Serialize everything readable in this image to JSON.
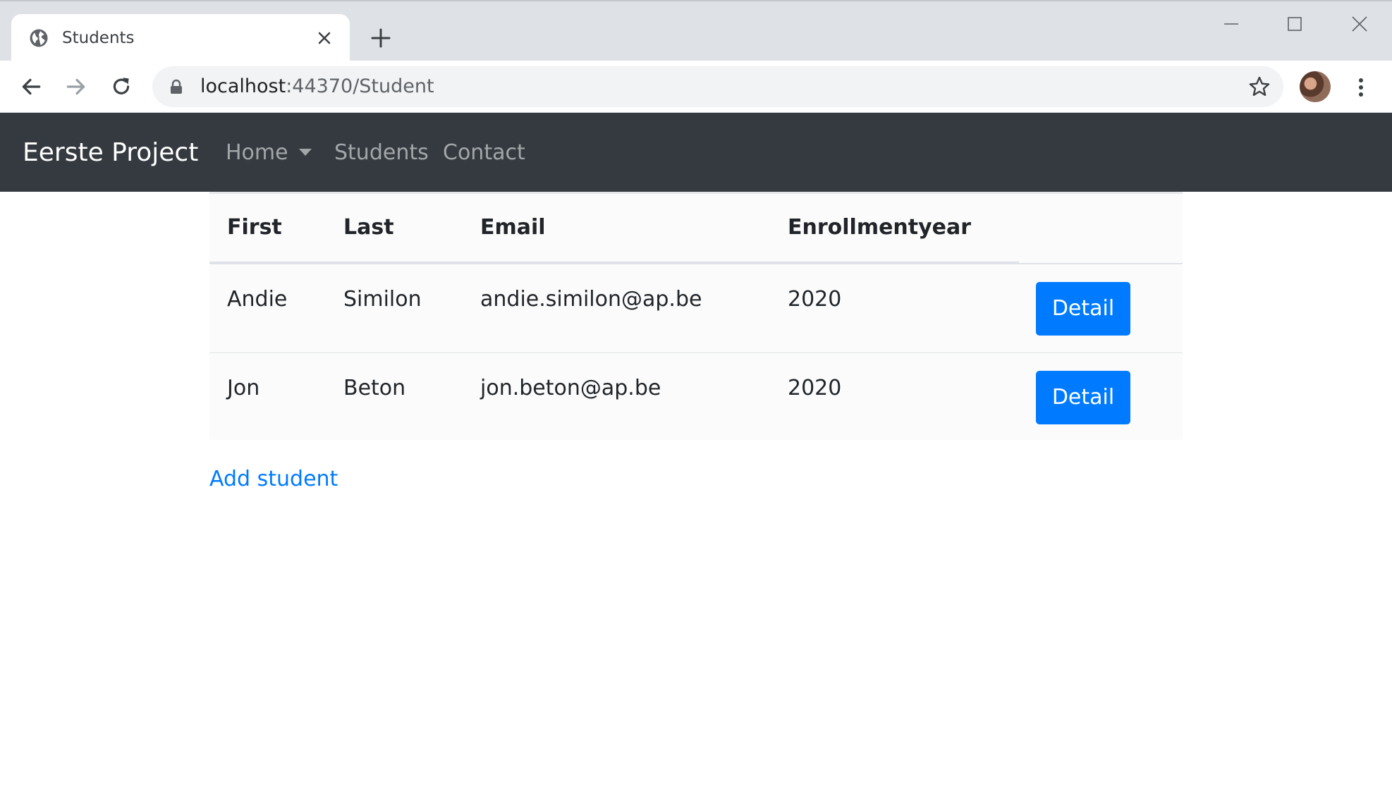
{
  "browser": {
    "tab": {
      "title": "Students",
      "icon": "globe-icon"
    },
    "url": {
      "host": "localhost",
      "rest": ":44370/Student"
    },
    "icons": {
      "back": "arrow-left-icon",
      "forward": "arrow-right-icon",
      "reload": "reload-icon",
      "lock": "lock-icon",
      "star": "star-icon",
      "menu": "more-vert-icon",
      "new_tab": "plus-icon",
      "close_tab": "close-icon"
    }
  },
  "navbar": {
    "brand": "Eerste Project",
    "links": [
      "Home",
      "Students",
      "Contact"
    ],
    "background": "#343a40"
  },
  "table": {
    "headers": [
      "First",
      "Last",
      "Email",
      "Enrollmentyear"
    ],
    "rows": [
      {
        "first": "Andie",
        "last": "Similon",
        "email": "andie.similon@ap.be",
        "year": "2020",
        "action": "Detail"
      },
      {
        "first": "Jon",
        "last": "Beton",
        "email": "jon.beton@ap.be",
        "year": "2020",
        "action": "Detail"
      }
    ]
  },
  "add_student": "Add student",
  "colors": {
    "primary": "#007bff",
    "text": "#212529"
  }
}
